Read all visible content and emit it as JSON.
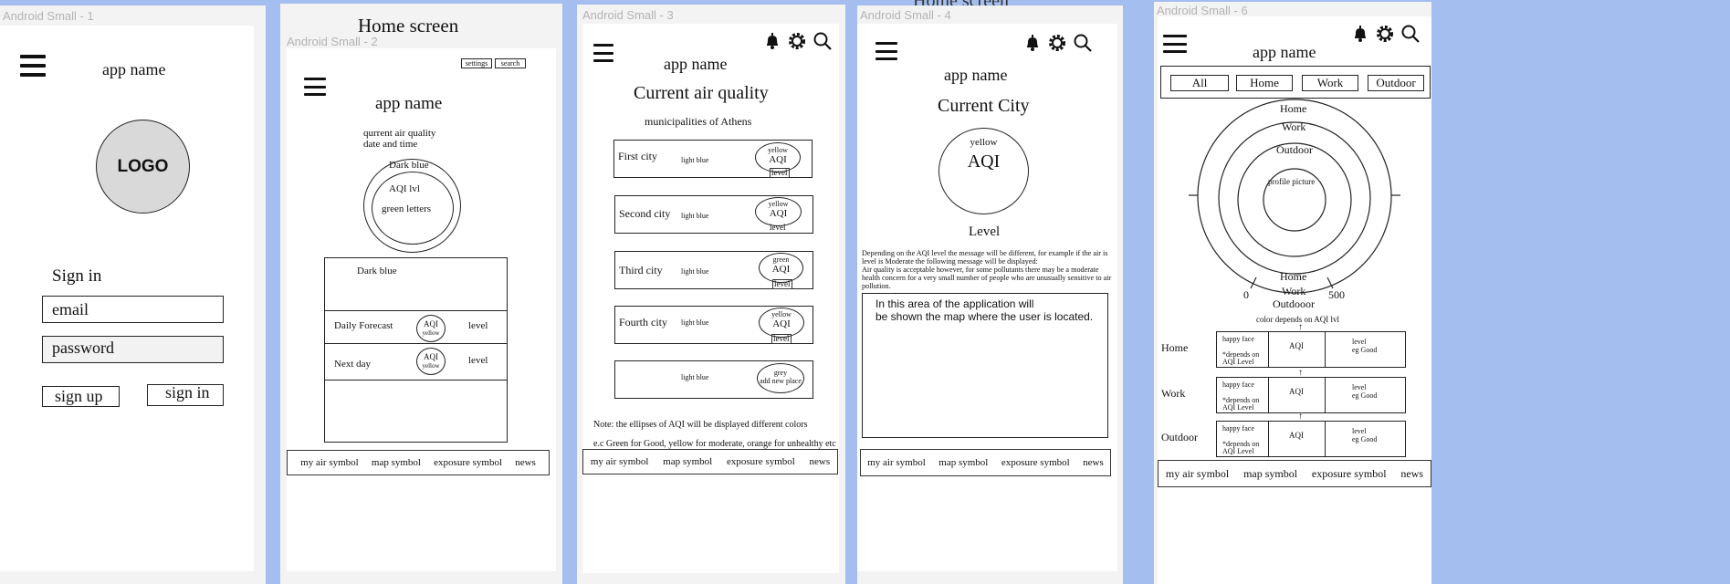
{
  "colors": {
    "background": "#a4bfef",
    "frame": "#f3f3f3",
    "screen": "#ffffff",
    "logo_fill": "#d9d9d9",
    "password_fill": "#f2f2f2"
  },
  "top_title": "Home screen",
  "frame_labels": [
    "Android Small - 1",
    "Android Small - 2",
    "Android Small - 3",
    "Android Small - 4",
    "Android Small - 6"
  ],
  "nav": {
    "my_air": "my air symbol",
    "map": "map symbol",
    "exposure": "exposure symbol",
    "news": "news"
  },
  "icons": [
    "menu-icon",
    "bell-icon",
    "gear-icon",
    "search-icon"
  ],
  "s1": {
    "app_name": "app name",
    "logo": "LOGO",
    "sign_in_heading": "Sign in",
    "email": "email",
    "password": "password",
    "sign_up": "sign up",
    "sign_in": "sign in"
  },
  "s2": {
    "settings": "settings",
    "search": "search",
    "app_name": "app name",
    "subtitle": "qurrent air quality\ndate and time",
    "outer": "Dark blue",
    "aqi": "AQI lvl",
    "green": "green letters",
    "panel": "Dark blue",
    "rows": [
      {
        "label": "Daily Forecast",
        "aqi": "AQI",
        "color": "yellow",
        "level": "level"
      },
      {
        "label": "Next day",
        "aqi": "AQI",
        "color": "yellow",
        "level": "level"
      }
    ]
  },
  "s3": {
    "app_name": "app name",
    "title": "Current air quality",
    "subtitle": "municipalities of Athens",
    "cities": [
      {
        "name": "First city",
        "color_note": "light blue",
        "ellipse_color": "yellow",
        "aqi": "AQI",
        "level": "level"
      },
      {
        "name": "Second city",
        "color_note": "light blue",
        "ellipse_color": "yellow",
        "aqi": "AQI",
        "level": "level"
      },
      {
        "name": "Third city",
        "color_note": "light blue",
        "ellipse_color": "green",
        "aqi": "AQI",
        "level": "level"
      },
      {
        "name": "Fourth city",
        "color_note": "light blue",
        "ellipse_color": "yellow",
        "aqi": "AQI",
        "level": "level"
      },
      {
        "name": "",
        "color_note": "light blue",
        "ellipse_color": "grey",
        "aqi": "add new place",
        "level": ""
      }
    ],
    "note1": "Note: the ellipses of AQI will be displayed different colors",
    "note2": "e.c Green for Good, yellow for moderate, orange for unhealthy etc"
  },
  "s4": {
    "app_name": "app name",
    "title": "Current City",
    "circle_color": "yellow",
    "aqi": "AQI",
    "level": "Level",
    "description": "Depending on the AQI level the message will be different, for example if the air is level is Moderate the following message will be displayed:\nAir quality is acceptable however, for some pollutants there may be a moderate health concern for a very small number of people who are unusually sensitive to air pollution.",
    "map_text": "In this area of the application will\nbe shown the map where the user is located."
  },
  "s6": {
    "app_name": "app name",
    "filters": [
      "All",
      "Home",
      "Work",
      "Outdoor"
    ],
    "rings": [
      "Home",
      "Work",
      "Outdoor"
    ],
    "center": "profile picture",
    "gauge_min": "0",
    "gauge_max": "500",
    "legend": [
      "Home",
      "Work",
      "Outdooor"
    ],
    "color_note": "color depends on AQI lvl",
    "rows": [
      {
        "label": "Home",
        "face": "happy face",
        "depends": "*depends on AQI Level",
        "aqi": "AQI",
        "level": "level\neg Good"
      },
      {
        "label": "Work",
        "face": "happy face",
        "depends": "*depends on AQI Level",
        "aqi": "AQI",
        "level": "level\neg Good"
      },
      {
        "label": "Outdoor",
        "face": "happy face",
        "depends": "*depends on AQI Level",
        "aqi": "AQI",
        "level": "level\neg Good"
      }
    ]
  }
}
